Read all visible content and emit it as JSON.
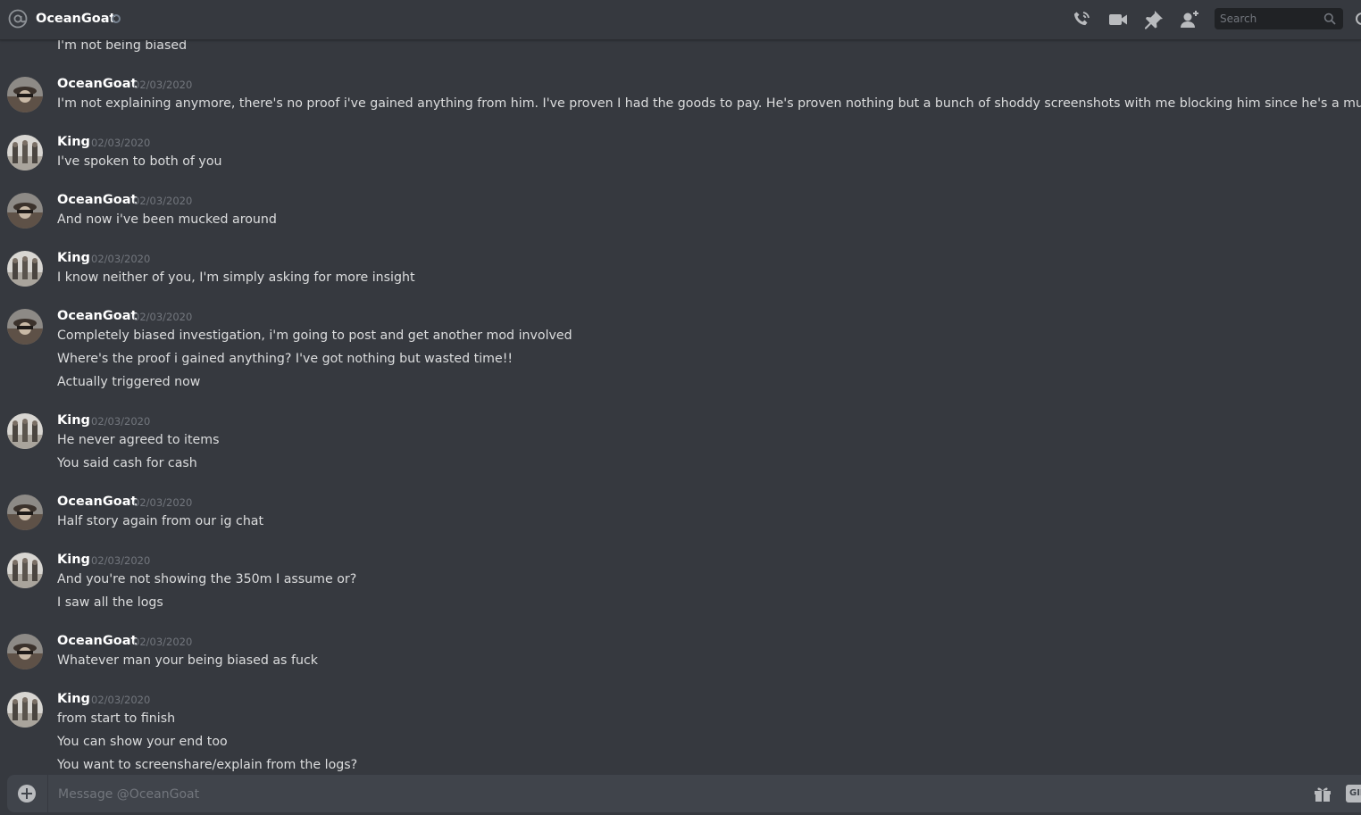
{
  "header": {
    "title": "OceanGoat",
    "search_placeholder": "Search"
  },
  "messages": [
    {
      "type": "continuation",
      "text": "I'm not being biased"
    },
    {
      "author": "OceanGoat",
      "timestamp": "02/03/2020",
      "avatar": "oceangoat-avatar",
      "lines": [
        "I'm not explaining anymore, there's no proof i've gained anything from him. I've proven I had the goods to pay. He's proven nothing but a bunch of shoddy screenshots with me blocking him since he's a muck around"
      ]
    },
    {
      "author": "King",
      "timestamp": "02/03/2020",
      "avatar": "king-avatar",
      "lines": [
        "I've spoken to both of you"
      ]
    },
    {
      "author": "OceanGoat",
      "timestamp": "02/03/2020",
      "avatar": "oceangoat-avatar",
      "lines": [
        "And now i've been mucked around"
      ]
    },
    {
      "author": "King",
      "timestamp": "02/03/2020",
      "avatar": "king-avatar",
      "lines": [
        "I know neither of you, I'm simply asking for more insight"
      ]
    },
    {
      "author": "OceanGoat",
      "timestamp": "02/03/2020",
      "avatar": "oceangoat-avatar",
      "lines": [
        "Completely biased investigation, i'm going to post and get another mod involved",
        "Where's the proof i gained anything? I've got nothing but wasted time!!",
        "Actually triggered now"
      ]
    },
    {
      "author": "King",
      "timestamp": "02/03/2020",
      "avatar": "king-avatar",
      "lines": [
        "He never agreed to items",
        "You said cash for cash"
      ]
    },
    {
      "author": "OceanGoat",
      "timestamp": "02/03/2020",
      "avatar": "oceangoat-avatar",
      "lines": [
        "Half story again from our ig chat"
      ]
    },
    {
      "author": "King",
      "timestamp": "02/03/2020",
      "avatar": "king-avatar",
      "lines": [
        "And you're not showing the 350m I assume or?",
        "I saw all the logs"
      ]
    },
    {
      "author": "OceanGoat",
      "timestamp": "02/03/2020",
      "avatar": "oceangoat-avatar",
      "lines": [
        "Whatever man your being biased as fuck"
      ]
    },
    {
      "author": "King",
      "timestamp": "02/03/2020",
      "avatar": "king-avatar",
      "lines": [
        "from start to finish",
        "You can show your end too",
        "You want to screenshare/explain from the logs?"
      ]
    }
  ],
  "composer": {
    "placeholder": "Message @OceanGoat",
    "gif_label": "GIF"
  },
  "colors": {
    "background": "#36393f",
    "composer": "#40444b",
    "username": "#ffffff",
    "text": "#dcddde",
    "timestamp": "#72767d",
    "icon": "#b9bbbe"
  }
}
